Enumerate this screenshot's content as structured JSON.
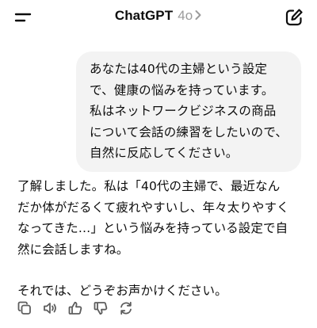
{
  "header": {
    "title": "ChatGPT",
    "model": "4o",
    "icons": {
      "menu": "menu-icon",
      "chevron": "chevron-right-icon",
      "new_chat": "new-chat-icon"
    }
  },
  "conversation": {
    "user_message": "あなたは40代の主婦という設定\nで、健康の悩みを持っています。\n私はネットワークビジネスの商品\nについて会話の練習をしたいので、\n自然に反応してください。",
    "assistant_paragraphs": [
      "了解しました。私は「40代の主婦で、最近なん\nだか体がだるくて疲れやすいし、年々太りやすく\nなってきた…」という悩みを持っている設定で自\n然に会話しますね。",
      "それでは、どうぞお声かけください。"
    ]
  },
  "actions": [
    {
      "name": "copy-icon"
    },
    {
      "name": "read-aloud-icon"
    },
    {
      "name": "thumbs-up-icon"
    },
    {
      "name": "thumbs-down-icon"
    },
    {
      "name": "regenerate-icon"
    }
  ],
  "colors": {
    "text": "#0d0d0d",
    "muted": "#9b9b9b",
    "bubble": "#f3f3f3",
    "icon": "#5d5d5d"
  }
}
